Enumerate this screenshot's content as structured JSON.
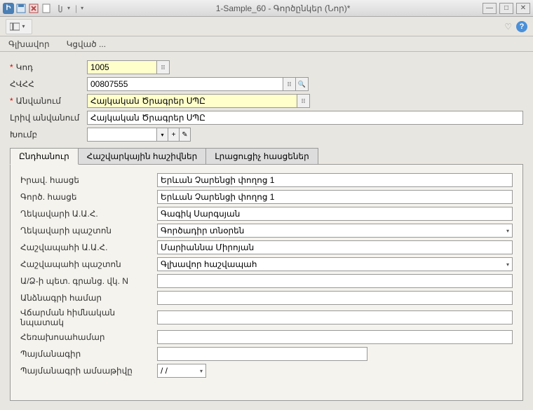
{
  "window": {
    "title": "1-Sample_60 - Գործընկեր (Նոր)*"
  },
  "menubar": {
    "item1": "Գլխավոր",
    "item2": "Կցված ..."
  },
  "form": {
    "code_label": "Կոդ",
    "code_value": "1005",
    "hvhh_label": "ՀՎՀՀ",
    "hvhh_value": "00807555",
    "name_label": "Անվանում",
    "name_value": "Հայկական Ծրագրեր ՍՊԸ",
    "fullname_label": "Լրիվ անվանում",
    "fullname_value": "Հայկական Ծրագրեր ՍՊԸ",
    "group_label": "Խումբ",
    "group_value": ""
  },
  "tabs": {
    "tab1": "Ընդհանուր",
    "tab2": "Հաշվարկային հաշիվներ",
    "tab3": "Լրացուցիչ հասցեներ"
  },
  "panel": {
    "legal_addr_label": "Իրավ. հասցե",
    "legal_addr_value": "Երևան Չարենցի փողոց 1",
    "biz_addr_label": "Գործ. հասցե",
    "biz_addr_value": "Երևան Չարենցի փողոց 1",
    "director_name_label": "Ղեկավարի Ա.Ա.Հ.",
    "director_name_value": "Գագիկ Սարգսյան",
    "director_pos_label": "Ղեկավարի պաշտոն",
    "director_pos_value": "Գործադիր տնօրեն",
    "accountant_name_label": "Հաշվապահի Ա.Ա.Հ.",
    "accountant_name_value": "Մարիաննա Միրոյան",
    "accountant_pos_label": "Հաշվապահի պաշտոն",
    "accountant_pos_value": "Գլխավոր հաշվապահ",
    "cert_label": "Ա/Ձ-ի պետ. գրանց. վկ. N",
    "cert_value": "",
    "passport_label": "Անձնագրի համար",
    "passport_value": "",
    "payment_label": "Վճարման հիմնական նպատակ",
    "payment_value": "",
    "phone_label": "Հեռախոսահամար",
    "phone_value": "",
    "contract_label": "Պայմանագիր",
    "contract_value": "",
    "contract_date_label": "Պայմանագրի ամսաթիվը",
    "contract_date_value": "  /  /"
  }
}
